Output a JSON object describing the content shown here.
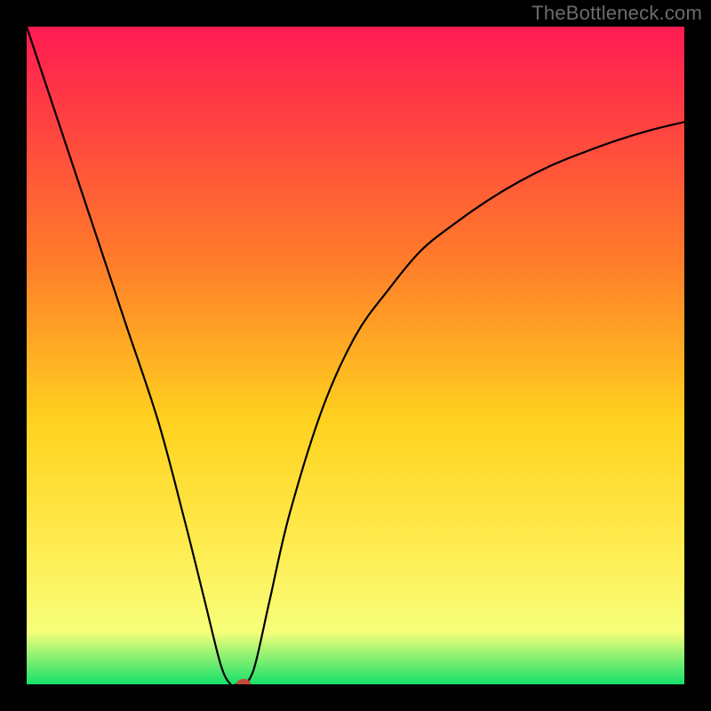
{
  "watermark": "TheBottleneck.com",
  "colors": {
    "frame": "#000000",
    "gradient_top": "#ff1a52",
    "gradient_mid_upper": "#ff7a2a",
    "gradient_mid": "#ffd21f",
    "gradient_mid_lower": "#ffea4d",
    "gradient_low": "#f7ff7a",
    "gradient_bottom": "#16e06a",
    "curve": "#000000",
    "marker": "#c24a3d"
  },
  "chart_data": {
    "type": "line",
    "title": "",
    "xlabel": "",
    "ylabel": "",
    "xlim": [
      0,
      100
    ],
    "ylim": [
      0,
      100
    ],
    "x": [
      0,
      5,
      10,
      15,
      20,
      24,
      27,
      29.5,
      31,
      32,
      33,
      34,
      35,
      37,
      40,
      45,
      50,
      55,
      60,
      65,
      70,
      75,
      80,
      85,
      90,
      95,
      100
    ],
    "values": [
      100,
      85,
      70,
      55,
      40,
      25,
      13,
      3,
      0,
      0,
      0,
      1,
      4,
      13,
      26,
      42,
      53,
      60,
      66,
      70,
      73.5,
      76.5,
      79,
      81,
      82.8,
      84.3,
      85.5
    ],
    "series": [
      {
        "name": "bottleneck-curve",
        "x_ref": "x",
        "y_ref": "values"
      }
    ],
    "marker": {
      "x": 33,
      "y": 0,
      "r_pct": 1.1
    },
    "annotations": []
  }
}
